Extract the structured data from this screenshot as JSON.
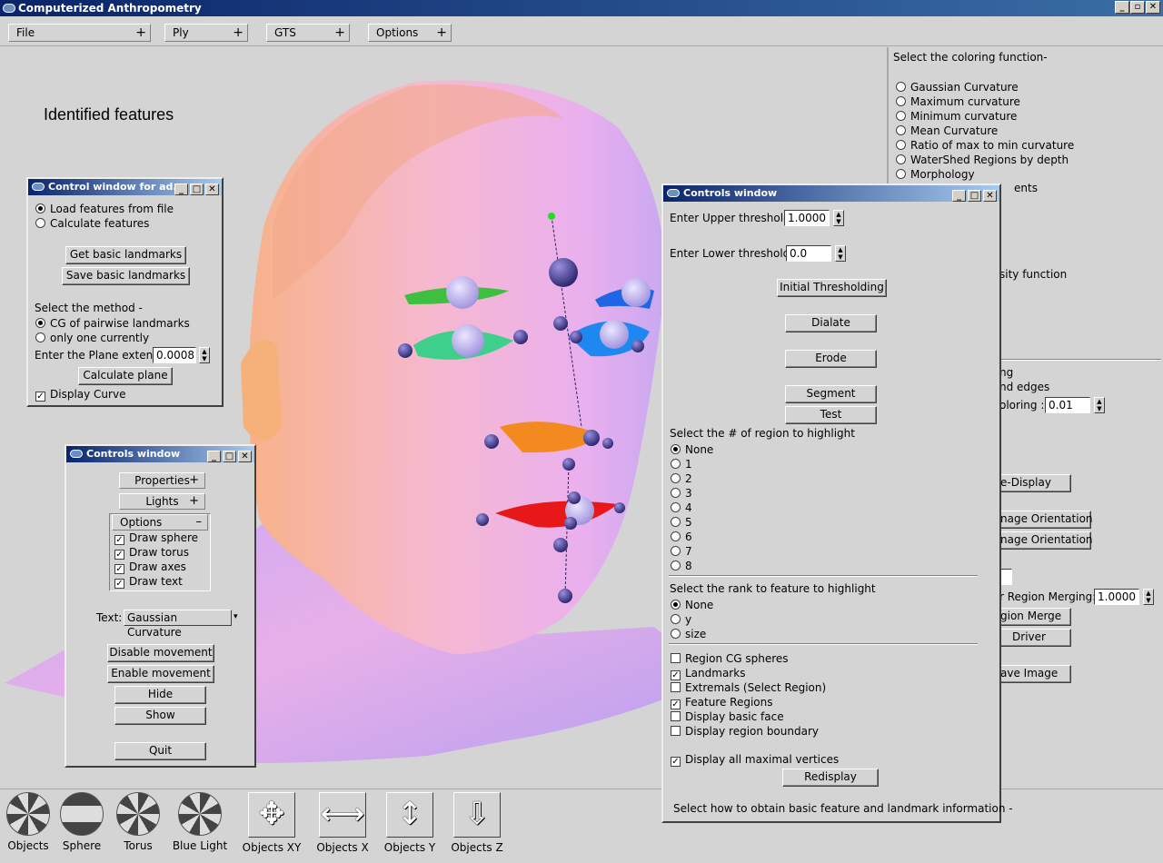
{
  "app": {
    "title": "Computerized Anthropometry"
  },
  "menubar": {
    "items": [
      "File",
      "Ply",
      "GTS",
      "Options"
    ]
  },
  "viewport": {
    "overlay_text": "Identified features"
  },
  "right_panel": {
    "heading": "Select the coloring function-",
    "options": [
      "Gaussian Curvature",
      "Maximum curvature",
      "Minimum curvature",
      "Mean Curvature",
      "Ratio of max to min curvature",
      "WaterShed Regions by depth",
      "Morphology"
    ],
    "partial": {
      "ents": "ents",
      "sity_function": "sity function",
      "ng": "ng",
      "nd_edges": "nd edges",
      "oloring": "oloring :",
      "oloring_value": "0.01",
      "e_display": "e-Display",
      "nage_orientation_1": "nage Orientation",
      "nage_orientation_2": "nage Orientation",
      "r_region_merging": "r Region Merging:",
      "r_region_merging_value": "1.0000",
      "gion_merge": "gion Merge",
      "driver": "Driver",
      "ave_image": "ave Image"
    }
  },
  "features_window": {
    "title": "Control window for ad...",
    "radio1": "Load features from file",
    "radio2": "Calculate features",
    "btn_get": "Get basic landmarks",
    "btn_save": "Save basic landmarks",
    "method_label": "Select the method -",
    "method1": "CG of pairwise landmarks",
    "method2": "only one currently",
    "plane_label": "Enter the Plane extent:",
    "plane_value": "0.0008",
    "btn_calc": "Calculate plane",
    "display_curve": "Display Curve"
  },
  "controls_small": {
    "title": "Controls window",
    "properties": "Properties",
    "lights": "Lights",
    "options": "Options",
    "checks": [
      "Draw sphere",
      "Draw torus",
      "Draw axes",
      "Draw text"
    ],
    "text_label": "Text:",
    "text_value": "Gaussian Curvature",
    "btn_disable": "Disable movement",
    "btn_enable": "Enable movement",
    "btn_hide": "Hide",
    "btn_show": "Show",
    "btn_quit": "Quit"
  },
  "controls_main": {
    "title": "Controls window",
    "upper_label": "Enter Upper threshold:",
    "upper_value": "1.0000",
    "lower_label": "Enter Lower threshold:",
    "lower_value": "0.0",
    "btn_initial": "Initial Thresholding",
    "btn_dialate": "Dialate",
    "btn_erode": "Erode",
    "btn_segment": "Segment",
    "btn_test": "Test",
    "region_label": "Select the # of region to highlight",
    "regions": [
      "None",
      "1",
      "2",
      "3",
      "4",
      "5",
      "6",
      "7",
      "8"
    ],
    "rank_label": "Select the rank to feature to highlight",
    "ranks": [
      "None",
      "y",
      "size"
    ],
    "checks": [
      {
        "label": "Region CG spheres",
        "checked": false
      },
      {
        "label": "Landmarks",
        "checked": true
      },
      {
        "label": "Extremals (Select Region)",
        "checked": false
      },
      {
        "label": "Feature Regions",
        "checked": true
      },
      {
        "label": "Display basic face",
        "checked": false
      },
      {
        "label": "Display region boundary",
        "checked": false
      }
    ],
    "maximal": "Display all maximal vertices",
    "btn_redisplay": "Redisplay",
    "footer": "Select how to obtain basic feature and landmark information -"
  },
  "toolbar": {
    "items": [
      "Objects",
      "Sphere",
      "Torus",
      "Blue Light",
      "Objects XY",
      "Objects X",
      "Objects Y",
      "Objects Z"
    ]
  },
  "colors": {
    "title_blue": "#0a246a",
    "face_pink": "#f0b0e8",
    "face_orange": "#f8b890",
    "landmark": "#4a3f9a"
  }
}
